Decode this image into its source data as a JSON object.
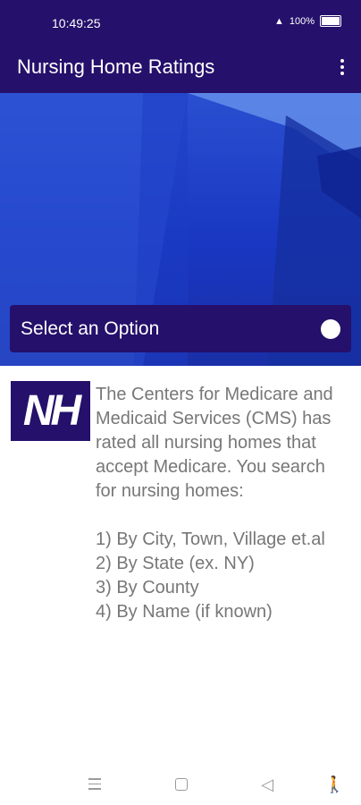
{
  "status_bar": {
    "time": "10:49:25",
    "battery": "100%"
  },
  "app_bar": {
    "title": "Nursing Home Ratings",
    "overflow_icon": "more-vert-icon"
  },
  "select": {
    "label": "Select an Option",
    "icon": "arrow-down-circle-icon"
  },
  "logo": {
    "text": "NH"
  },
  "description": "The Centers for Medicare and Medicaid Services (CMS) has rated all nursing homes that accept Medicare. You search for nursing homes:\n\n 1) By City, Town, Village et.al\n 2) By State (ex. NY)\n 3) By County\n 4) By Name (if known)",
  "colors": {
    "primary": "#25106b",
    "text_gray": "#777777"
  },
  "nav_bar": {
    "icons": [
      "menu-icon",
      "home-icon",
      "back-icon",
      "accessibility-icon"
    ]
  }
}
